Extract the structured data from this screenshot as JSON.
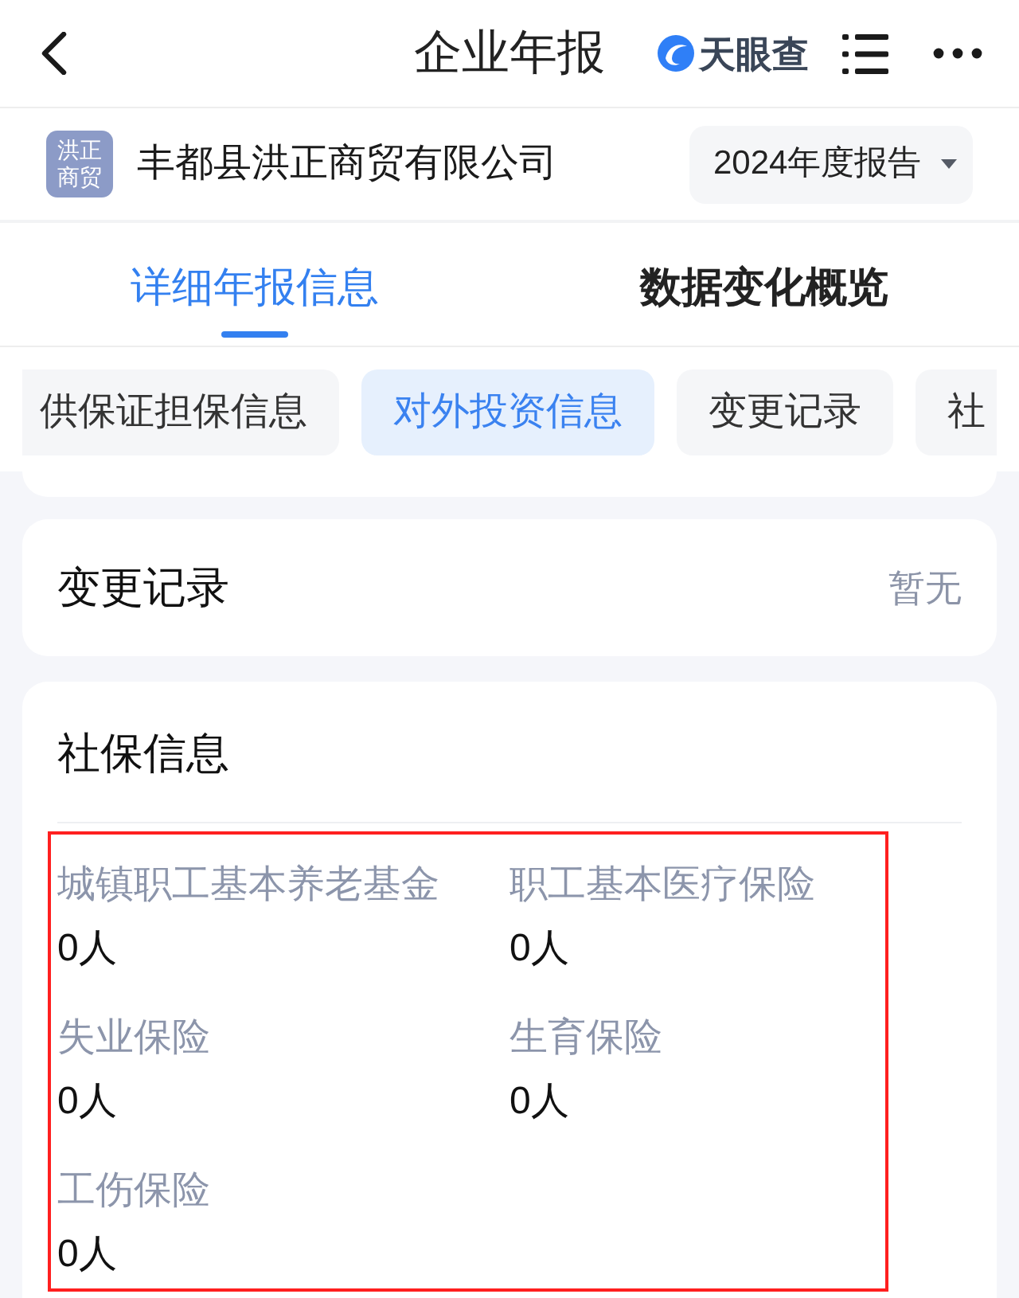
{
  "nav": {
    "title": "企业年报",
    "brand": "天眼查"
  },
  "company": {
    "avatar_text": "洪正商贸",
    "name": "丰都县洪正商贸有限公司",
    "report_year": "2024年度报告"
  },
  "tabs": [
    {
      "label": "详细年报信息",
      "selected": true
    },
    {
      "label": "数据变化概览",
      "selected": false
    }
  ],
  "section_chips": [
    {
      "label": "供保证担保信息",
      "selected": false
    },
    {
      "label": "对外投资信息",
      "selected": true
    },
    {
      "label": "变更记录",
      "selected": false
    },
    {
      "label": "社",
      "selected": false
    }
  ],
  "cards": [
    {
      "kind": "summary",
      "title": "变更记录",
      "status": "暂无"
    },
    {
      "kind": "fields",
      "title": "社保信息",
      "highlighted": true,
      "fields": [
        {
          "label": "城镇职工基本养老基金",
          "value": "0人"
        },
        {
          "label": "职工基本医疗保险",
          "value": "0人"
        },
        {
          "label": "失业保险",
          "value": "0人"
        },
        {
          "label": "生育保险",
          "value": "0人"
        },
        {
          "label": "工伤保险",
          "value": "0人"
        }
      ]
    }
  ]
}
